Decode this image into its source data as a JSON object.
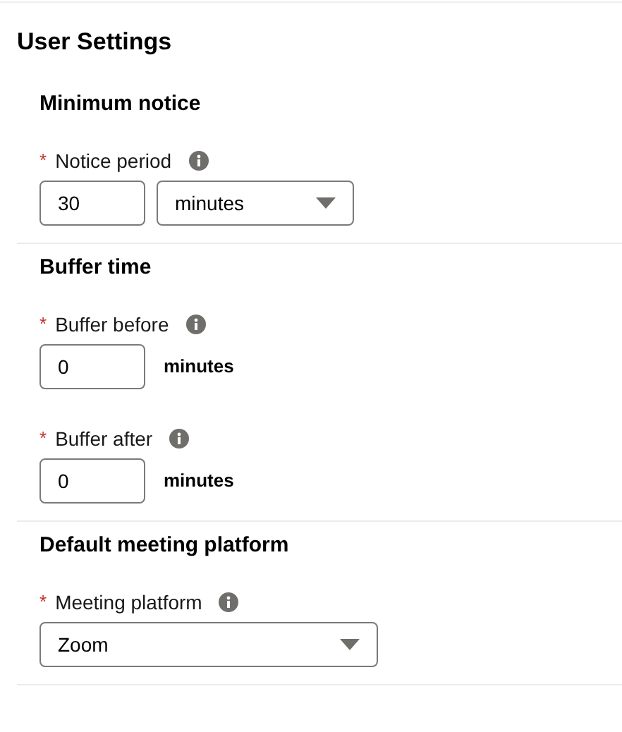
{
  "title": "User Settings",
  "sections": [
    {
      "heading": "Minimum notice",
      "fields": [
        {
          "kind": "input_select",
          "required_mark": "*",
          "label": "Notice period",
          "value": "30",
          "select_value": "minutes"
        }
      ]
    },
    {
      "heading": "Buffer time",
      "fields": [
        {
          "kind": "input_unit",
          "required_mark": "*",
          "label": "Buffer before",
          "value": "0",
          "unit": "minutes"
        },
        {
          "kind": "input_unit",
          "required_mark": "*",
          "label": "Buffer after",
          "value": "0",
          "unit": "minutes"
        }
      ]
    },
    {
      "heading": "Default meeting platform",
      "fields": [
        {
          "kind": "select",
          "required_mark": "*",
          "label": "Meeting platform",
          "value": "Zoom"
        }
      ]
    }
  ]
}
